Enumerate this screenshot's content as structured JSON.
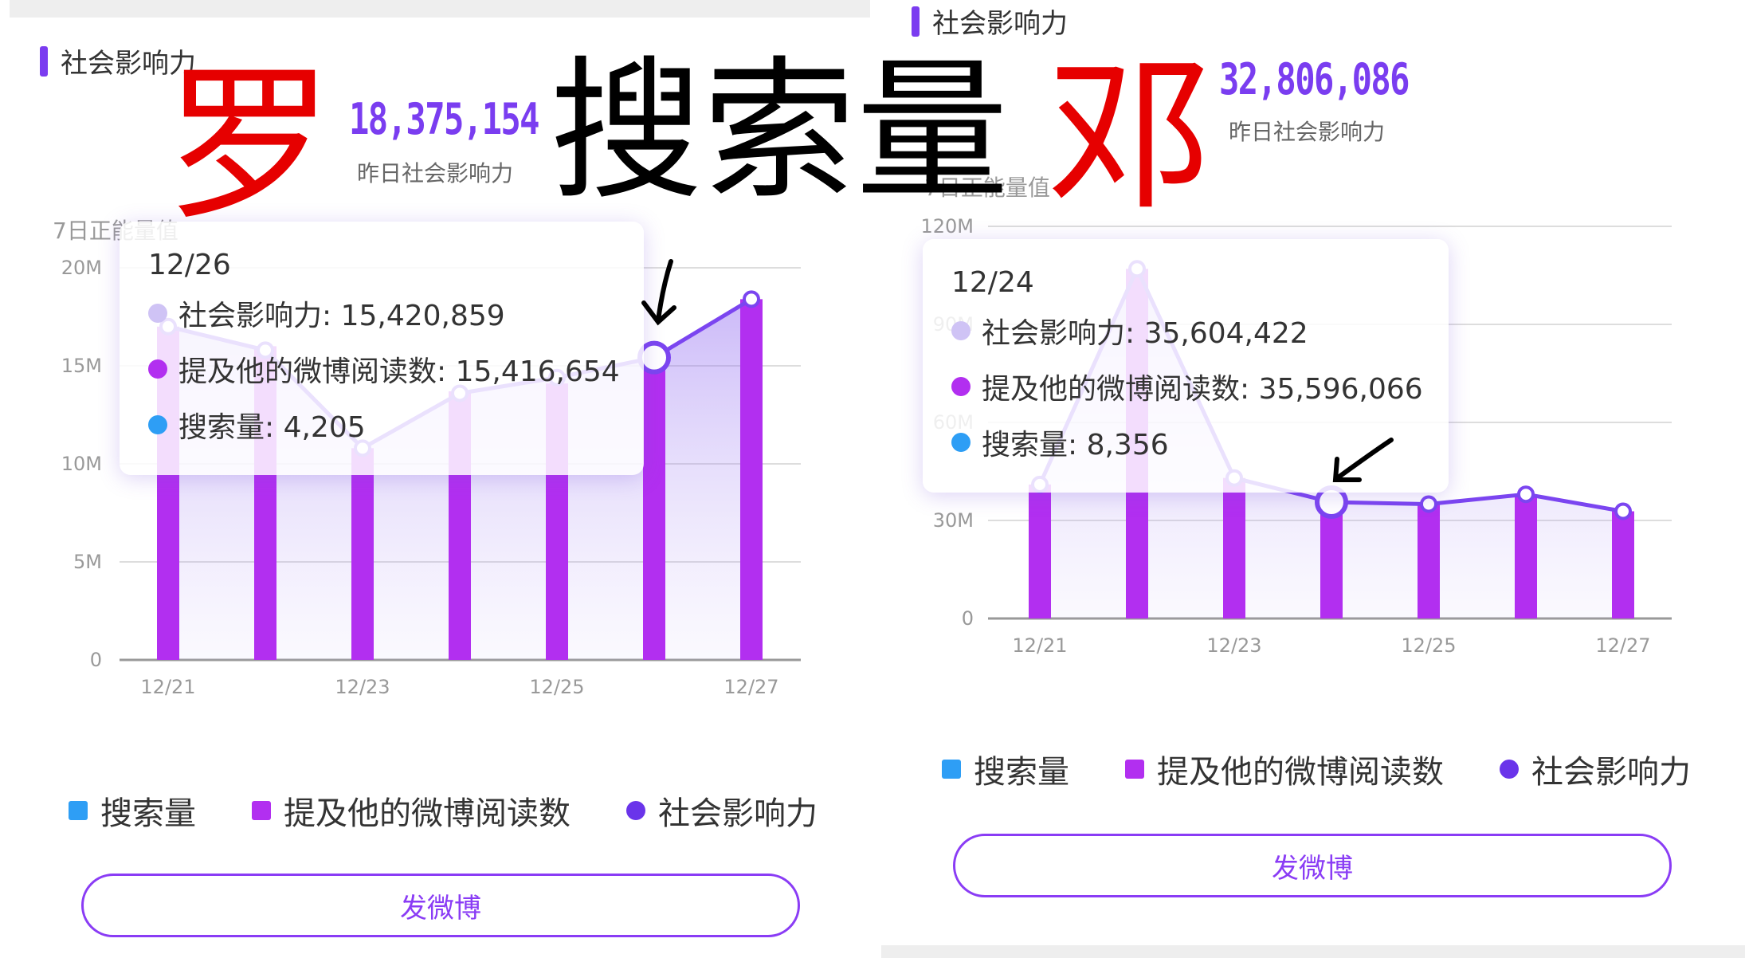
{
  "overlay": {
    "left_name": "罗",
    "center_title": "搜索量",
    "right_name": "邓"
  },
  "left": {
    "section_title": "社会影响力",
    "yesterday_value": "18,375,154",
    "yesterday_label": "昨日社会影响力",
    "chart_title": "7日正能量值",
    "tooltip": {
      "date": "12/26",
      "rows": [
        {
          "label": "社会影响力: 15,420,859",
          "color": "#cfc3f5"
        },
        {
          "label": "提及他的微博阅读数: 15,416,654",
          "color": "#b22ff0"
        },
        {
          "label": "搜索量: 4,205",
          "color": "#2e9ef5"
        }
      ]
    },
    "legend": [
      "搜索量",
      "提及他的微博阅读数",
      "社会影响力"
    ],
    "button": "发微博"
  },
  "right": {
    "section_title": "社会影响力",
    "yesterday_value": "32,806,086",
    "yesterday_label": "昨日社会影响力",
    "chart_title": "7日正能量值",
    "tooltip": {
      "date": "12/24",
      "rows": [
        {
          "label": "社会影响力: 35,604,422",
          "color": "#cfc3f5"
        },
        {
          "label": "提及他的微博阅读数: 35,596,066",
          "color": "#b22ff0"
        },
        {
          "label": "搜索量: 8,356",
          "color": "#2e9ef5"
        }
      ]
    },
    "legend": [
      "搜索量",
      "提及他的微博阅读数",
      "社会影响力"
    ],
    "button": "发微博"
  },
  "colors": {
    "accent": "#7a3df0",
    "bar": "#b22ff0",
    "line": "#7b45f0",
    "search": "#2e9ef5",
    "social": "#6a34ea",
    "red": "#e60000"
  },
  "chart_data": [
    {
      "type": "bar",
      "title": "7日正能量值",
      "categories": [
        "12/21",
        "12/22",
        "12/23",
        "12/24",
        "12/25",
        "12/26",
        "12/27"
      ],
      "x_tick_labels": [
        "12/21",
        "12/23",
        "12/25",
        "12/27"
      ],
      "y_tick_labels": [
        "0",
        "5M",
        "10M",
        "15M",
        "20M"
      ],
      "ylim": [
        0,
        20000000
      ],
      "grid": true,
      "legend_position": "bottom",
      "series": [
        {
          "name": "提及他的微博阅读数",
          "kind": "bar",
          "values": [
            17000000,
            16000000,
            10800000,
            13700000,
            14100000,
            15416654,
            18400000
          ]
        },
        {
          "name": "社会影响力",
          "kind": "area-line",
          "values": [
            17000000,
            15800000,
            10800000,
            13600000,
            14400000,
            15420859,
            18400000
          ]
        }
      ],
      "highlight_index": 5
    },
    {
      "type": "bar",
      "title": "7日正能量值",
      "categories": [
        "12/21",
        "12/22",
        "12/23",
        "12/24",
        "12/25",
        "12/26",
        "12/27"
      ],
      "x_tick_labels": [
        "12/21",
        "12/23",
        "12/25",
        "12/27"
      ],
      "y_tick_labels": [
        "0",
        "30M",
        "60M",
        "90M",
        "120M"
      ],
      "ylim": [
        0,
        120000000
      ],
      "grid": true,
      "legend_position": "bottom",
      "series": [
        {
          "name": "提及他的微博阅读数",
          "kind": "bar",
          "values": [
            41000000,
            107000000,
            43000000,
            35596066,
            35000000,
            38000000,
            32800000
          ]
        },
        {
          "name": "社会影响力",
          "kind": "area-line",
          "values": [
            41000000,
            107000000,
            43000000,
            35604422,
            35000000,
            38000000,
            32800000
          ]
        }
      ],
      "highlight_index": 3
    }
  ]
}
